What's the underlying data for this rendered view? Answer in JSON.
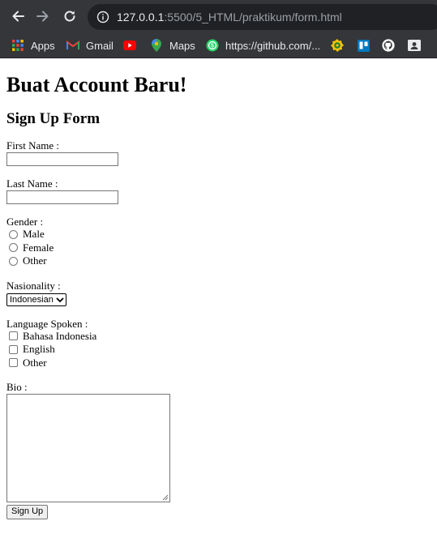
{
  "browser": {
    "url_host": "127.0.0.1",
    "url_path": ":5500/5_HTML/praktikum/form.html",
    "bookmarks": [
      {
        "label": "Apps",
        "icon": "apps-grid-icon"
      },
      {
        "label": "Gmail",
        "icon": "gmail-icon"
      },
      {
        "label": "",
        "icon": "youtube-icon"
      },
      {
        "label": "Maps",
        "icon": "maps-icon"
      },
      {
        "label": "https://github.com/...",
        "icon": "whatsapp-icon"
      },
      {
        "label": "",
        "icon": "badge-icon"
      },
      {
        "label": "",
        "icon": "trello-icon"
      },
      {
        "label": "",
        "icon": "github-icon"
      },
      {
        "label": "",
        "icon": "contact-card-icon"
      }
    ]
  },
  "page": {
    "title": "Buat Account Baru!",
    "subtitle": "Sign Up Form",
    "first_name_label": "First Name :",
    "last_name_label": "Last Name :",
    "gender_label": "Gender :",
    "gender_options": [
      "Male",
      "Female",
      "Other"
    ],
    "nationality_label": "Nasionality :",
    "nationality_selected": "Indonesian",
    "language_label": "Language Spoken :",
    "language_options": [
      "Bahasa Indonesia",
      "English",
      "Other"
    ],
    "bio_label": "Bio :",
    "submit_label": "Sign Up"
  }
}
